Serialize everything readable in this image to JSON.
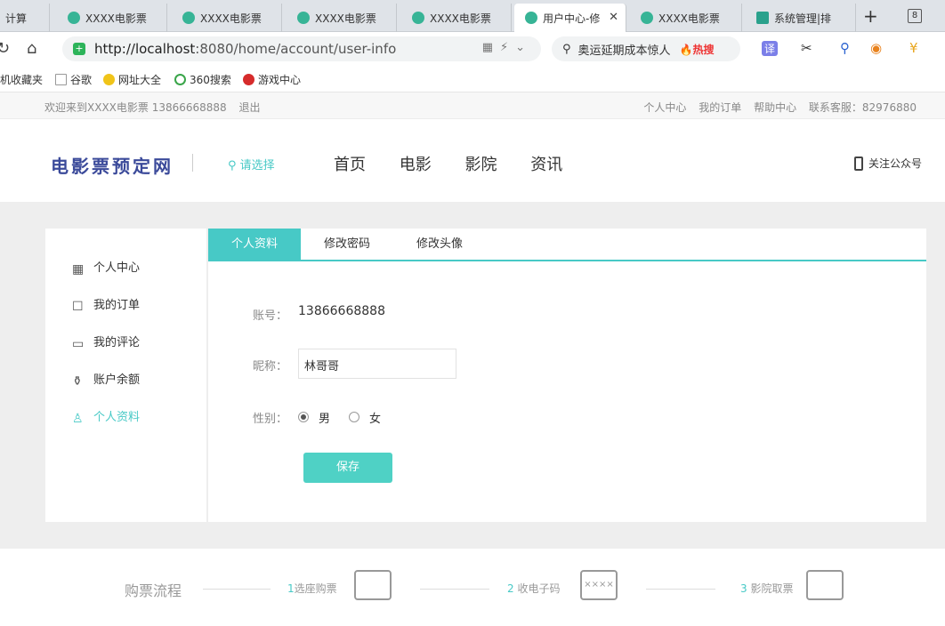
{
  "browser": {
    "tabs": [
      {
        "label": "计算"
      },
      {
        "label": "XXXX电影票"
      },
      {
        "label": "XXXX电影票"
      },
      {
        "label": "XXXX电影票"
      },
      {
        "label": "XXXX电影票"
      },
      {
        "label": "用户中心-修"
      },
      {
        "label": "XXXX电影票"
      },
      {
        "label": "系统管理|排"
      }
    ],
    "new_tab": "+",
    "tab_count": "8",
    "url_prefix": "http://localhost",
    "url_rest": ":8080/home/account/user-info",
    "search_text": "奥运延期成本惊人",
    "hot_label": "🔥热搜",
    "translate_label": "译",
    "bookmarks": [
      "机收藏夹",
      "谷歌",
      "网址大全",
      "360搜索",
      "游戏中心"
    ]
  },
  "site": {
    "welcome": "欢迎来到XXXX电影票 13866668888",
    "logout": "退出",
    "top_links": [
      "个人中心",
      "我的订单",
      "帮助中心",
      "联系客服：82976880"
    ],
    "logo": "电影票预定网",
    "city": "请选择",
    "nav": [
      "首页",
      "电影",
      "影院",
      "资讯"
    ],
    "follow": "关注公众号"
  },
  "sidebar": {
    "items": [
      {
        "label": "个人中心",
        "icon": "grid-icon"
      },
      {
        "label": "我的订单",
        "icon": "bag-icon"
      },
      {
        "label": "我的评论",
        "icon": "comment-icon"
      },
      {
        "label": "账户余额",
        "icon": "wallet-icon"
      },
      {
        "label": "个人资料",
        "icon": "user-icon",
        "active": true
      }
    ]
  },
  "profile": {
    "tabs": [
      "个人资料",
      "修改密码",
      "修改头像"
    ],
    "account_label": "账号：",
    "account_value": "13866668888",
    "nickname_label": "昵称：",
    "nickname_value": "林哥哥",
    "gender_label": "性别：",
    "gender_male": "男",
    "gender_female": "女",
    "gender_selected": "男",
    "save_label": "保存"
  },
  "flow": {
    "title": "购票流程",
    "steps": [
      {
        "num": "1",
        "label": "选座购票"
      },
      {
        "num": "2",
        "label": "收电子码"
      },
      {
        "num": "3",
        "label": "影院取票"
      }
    ],
    "code_icon_text": "××××"
  },
  "colors": {
    "accent": "#47c9c6",
    "logo": "#3b4a9a",
    "save": "#4fd1c5"
  }
}
